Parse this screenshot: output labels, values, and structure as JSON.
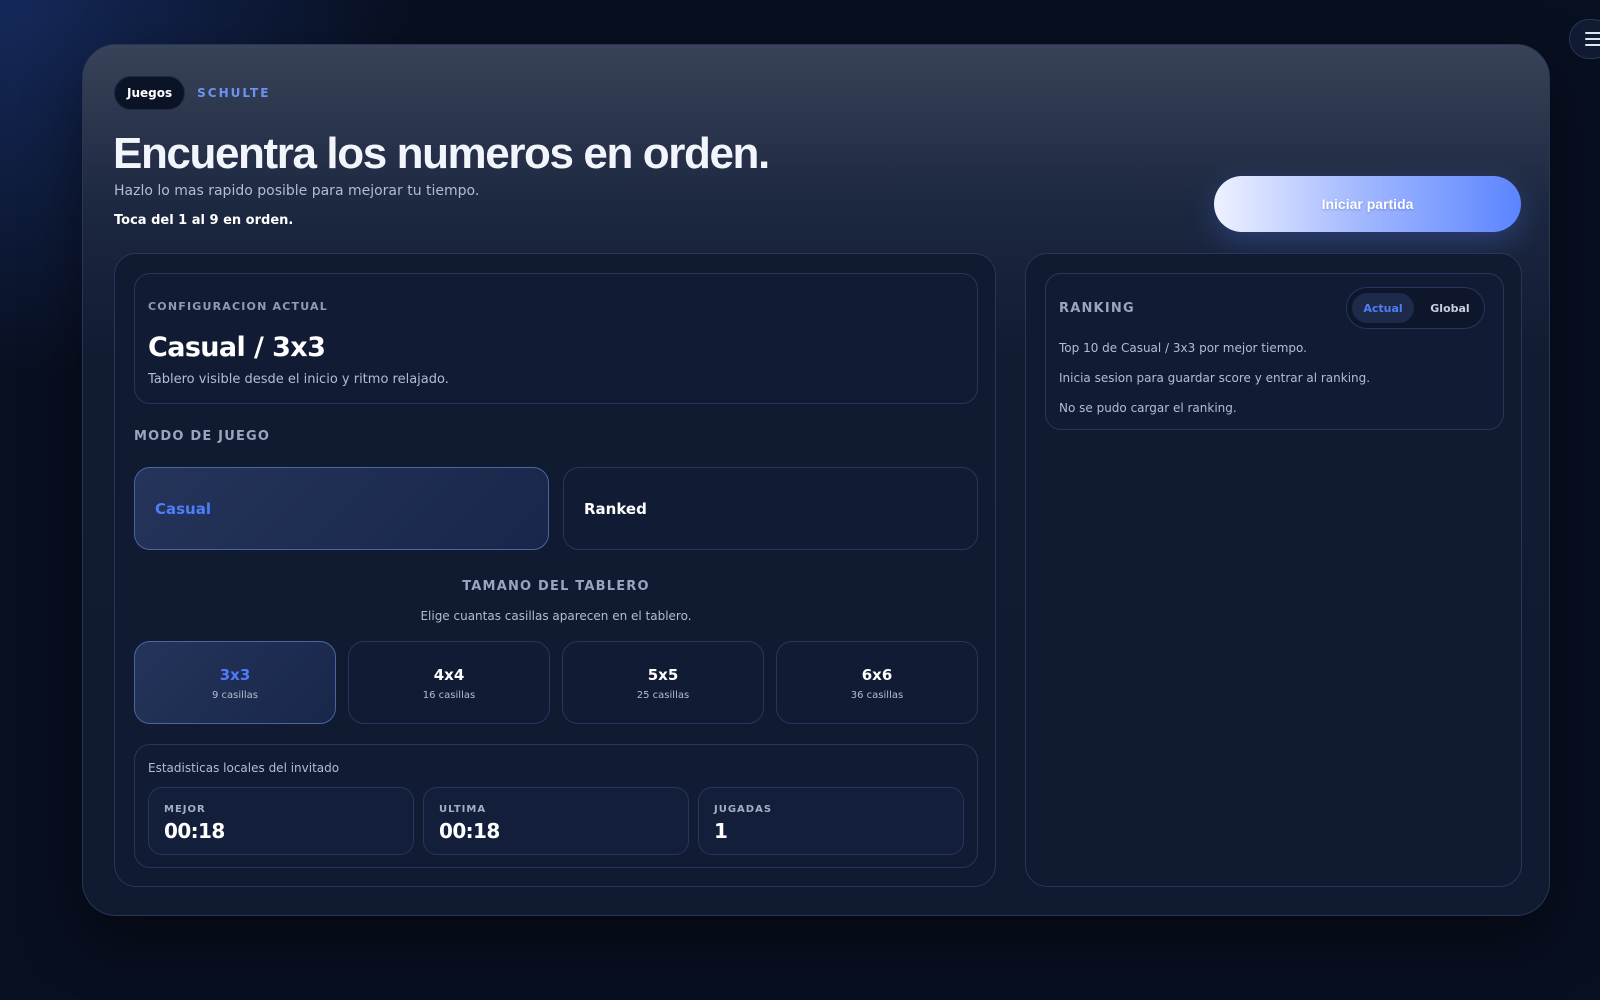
{
  "header": {
    "chip": "Juegos",
    "breadcrumb": "SCHULTE",
    "title": "Encuentra los numeros en orden.",
    "subtitle": "Hazlo lo mas rapido posible para mejorar tu tiempo.",
    "hint": "Toca del 1 al 9 en orden.",
    "start_button": "Iniciar partida"
  },
  "config": {
    "label": "CONFIGURACION ACTUAL",
    "value": "Casual / 3x3",
    "description": "Tablero visible desde el inicio y ritmo relajado."
  },
  "modes": {
    "label": "MODO DE JUEGO",
    "selected": "Casual",
    "options": [
      {
        "label": "Casual"
      },
      {
        "label": "Ranked"
      }
    ]
  },
  "board_size": {
    "title": "TAMANO DEL TABLERO",
    "description": "Elige cuantas casillas aparecen en el tablero.",
    "selected": "3x3",
    "options": [
      {
        "name": "3x3",
        "cells": "9 casillas"
      },
      {
        "name": "4x4",
        "cells": "16 casillas"
      },
      {
        "name": "5x5",
        "cells": "25 casillas"
      },
      {
        "name": "6x6",
        "cells": "36 casillas"
      }
    ]
  },
  "stats": {
    "title": "Estadisticas locales del invitado",
    "items": [
      {
        "label": "MEJOR",
        "value": "00:18"
      },
      {
        "label": "ULTIMA",
        "value": "00:18"
      },
      {
        "label": "JUGADAS",
        "value": "1"
      }
    ]
  },
  "ranking": {
    "title": "RANKING",
    "tabs": [
      "Actual",
      "Global"
    ],
    "selected_tab": "Actual",
    "lines": [
      "Top 10 de Casual / 3x3 por mejor tiempo.",
      "Inicia sesion para guardar score y entrar al ranking.",
      "No se pudo cargar el ranking."
    ]
  },
  "icons": {
    "menu": "menu-icon"
  },
  "colors": {
    "accent": "#4f7dfa",
    "background": "#080f20",
    "panel": "#101a30"
  }
}
